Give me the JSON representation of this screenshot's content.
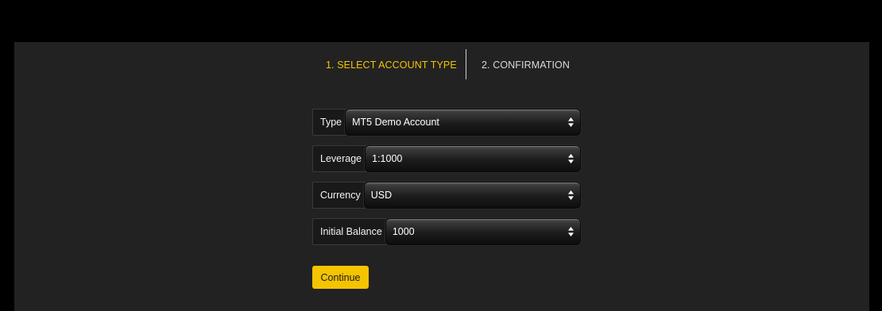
{
  "steps": {
    "step1": "1. SELECT ACCOUNT TYPE",
    "step2": "2. CONFIRMATION"
  },
  "form": {
    "type": {
      "label": "Type",
      "value": "MT5 Demo Account"
    },
    "leverage": {
      "label": "Leverage",
      "value": "1:1000"
    },
    "currency": {
      "label": "Currency",
      "value": "USD"
    },
    "initial_balance": {
      "label": "Initial Balance",
      "value": "1000"
    }
  },
  "continue_label": "Continue",
  "colors": {
    "accent": "#f5c400",
    "panel": "#222222",
    "background": "#000000"
  }
}
